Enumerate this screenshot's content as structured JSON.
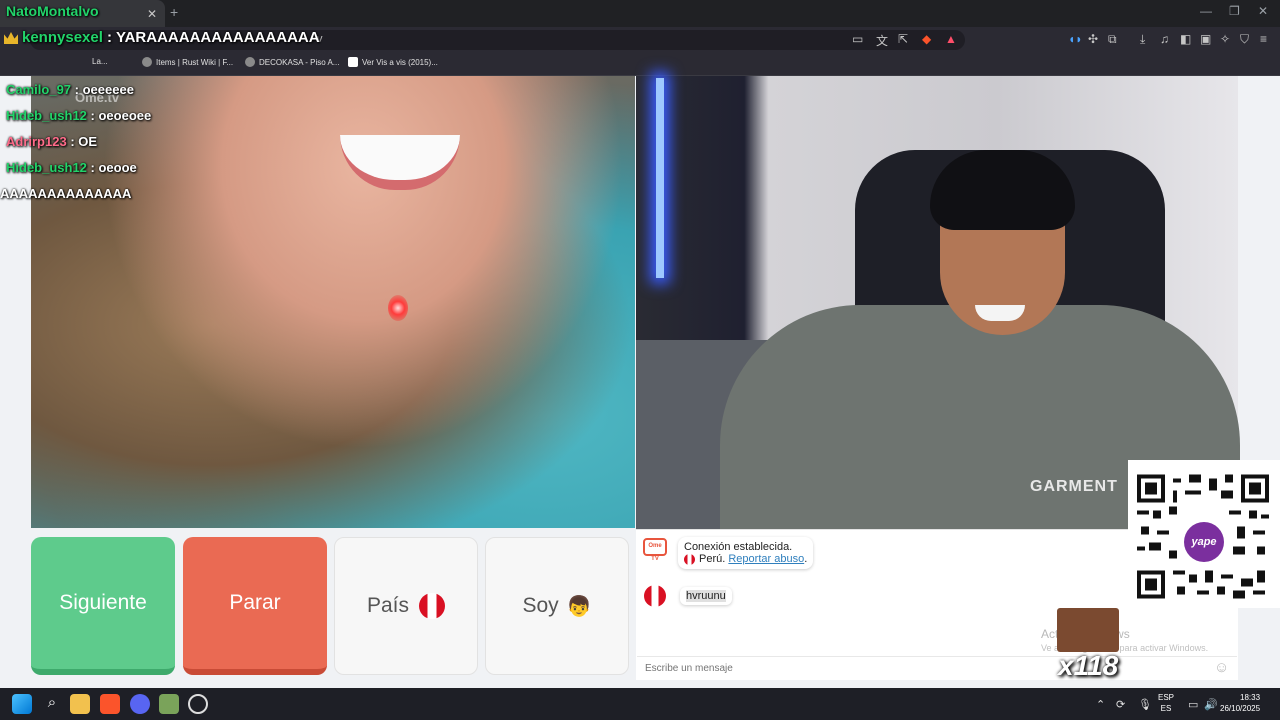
{
  "browser": {
    "tab_title": "NatoMontalvo",
    "address_text": "v",
    "bookmarks": [
      "Items | Rust Wiki | F...",
      "DECOKASA - Piso A...",
      "Ver Vis a vis (2015)..."
    ],
    "bookmark_prefix": "La..."
  },
  "overlay_chat": {
    "top_name": "NatoMontalvo",
    "lines": [
      {
        "user": "kennysexel",
        "text": "YARAAAAAAAAAAAAAAAA"
      },
      {
        "user": "",
        "text": ""
      },
      {
        "user": "Camilo_97",
        "text": "oeeeeee"
      },
      {
        "user": "Hideb_ush12",
        "text": "oeoeoee"
      },
      {
        "user": "Adrirp123",
        "text": "OE"
      },
      {
        "user": "Hideb_ush12",
        "text": "oeooe"
      },
      {
        "user": "",
        "text": "AAAAAAAAAAAAAA"
      }
    ],
    "separator": " : "
  },
  "video": {
    "watermark": "Ome.tv",
    "shirt_logo": "GARMENT"
  },
  "controls": {
    "next_label": "Siguiente",
    "stop_label": "Parar",
    "country_label": "País",
    "gender_label": "Soy"
  },
  "chat": {
    "tv_icon_label": "Ome TV",
    "system_message": "Conexión establecida.",
    "country": "Perú.",
    "report_link": "Reportar abuso",
    "report_suffix": ".",
    "user_message": "hvruunu",
    "input_placeholder": "Escribe un mensaje",
    "activate_title": "Activar Windows",
    "activate_sub": "Ve a Configuración para activar Windows."
  },
  "donation": {
    "qr_brand": "yape",
    "multiplier": "x118"
  },
  "taskbar": {
    "lang_top": "ESP",
    "lang_bottom": "ES",
    "time": "18:33",
    "date": "26/10/2025"
  },
  "colors": {
    "next_green": "#5ecb8c",
    "stop_red": "#ea6a53",
    "peru_red": "#d91023",
    "chat_green": "#22d46a"
  }
}
